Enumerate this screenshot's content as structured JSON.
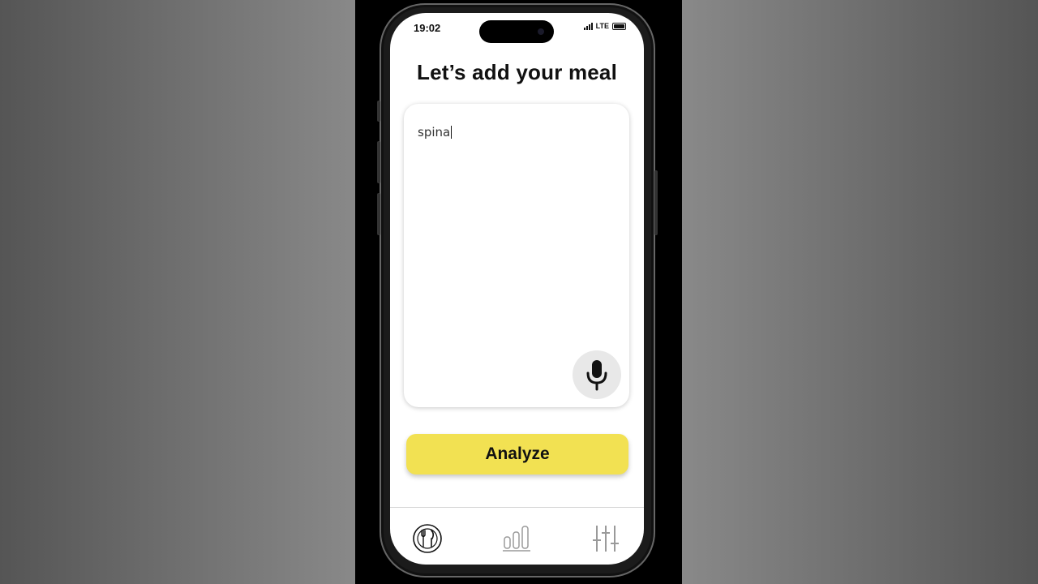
{
  "status_bar": {
    "time": "19:02",
    "network": "LTE"
  },
  "page": {
    "title": "Let’s add your meal"
  },
  "meal_input": {
    "value": "spina",
    "placeholder": ""
  },
  "mic_button": {
    "icon": "microphone-icon"
  },
  "analyze_button": {
    "label": "Analyze",
    "color": "#f2e152"
  },
  "tab_bar": {
    "items": [
      {
        "icon": "plate-fork-knife-icon",
        "active": true
      },
      {
        "icon": "bar-chart-icon",
        "active": false
      },
      {
        "icon": "sliders-icon",
        "active": false
      }
    ]
  },
  "colors": {
    "accent": "#f2e152",
    "text": "#111111",
    "inactive_icon": "#9a9a9a"
  }
}
